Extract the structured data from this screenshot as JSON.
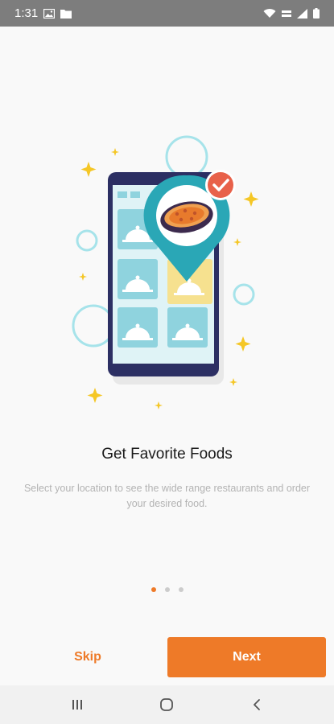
{
  "status_bar": {
    "time": "1:31",
    "left_icons": [
      "image-icon",
      "folder-icon"
    ],
    "right_icons": [
      "wifi-icon",
      "volte-icon",
      "signal-icon",
      "battery-icon"
    ]
  },
  "onboarding": {
    "title": "Get Favorite Foods",
    "description": "Select your location to see the wide range restaurants and order your desired food.",
    "page_index": 1,
    "page_count": 3
  },
  "actions": {
    "skip_label": "Skip",
    "next_label": "Next"
  },
  "nav_bar": {
    "buttons": [
      "recent-apps-icon",
      "home-icon",
      "back-icon"
    ]
  },
  "colors": {
    "accent": "#ee7a28",
    "status_bar": "#7d7d7d",
    "background": "#f9f9f9",
    "teal": "#2aa7b6"
  }
}
